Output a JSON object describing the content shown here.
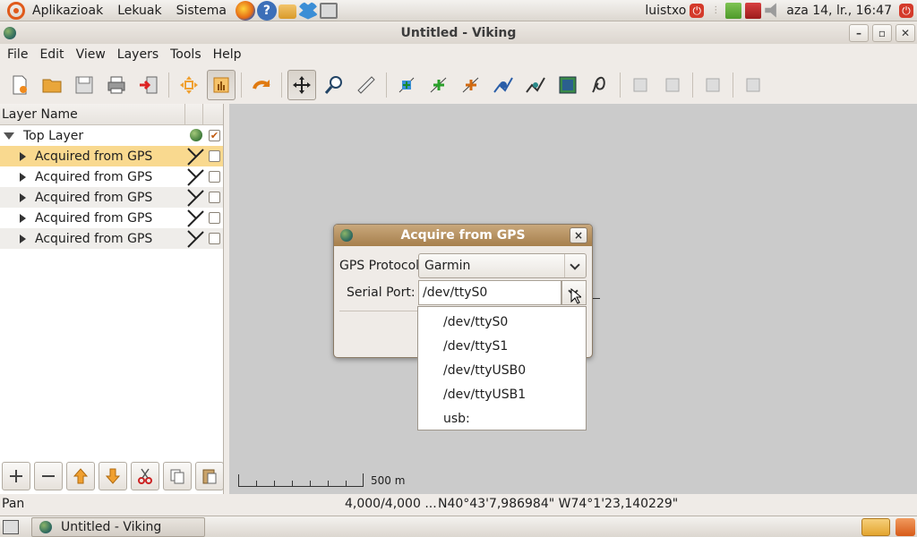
{
  "top_panel": {
    "menus": [
      "Aplikazioak",
      "Lekuak",
      "Sistema"
    ],
    "user": "luistxo",
    "clock": "aza 14, lr., 16:47",
    "help_glyph": "?"
  },
  "window": {
    "title": "Untitled - Viking",
    "buttons": [
      "–",
      "▫",
      "✕"
    ]
  },
  "menubar": [
    "File",
    "Edit",
    "View",
    "Layers",
    "Tools",
    "Help"
  ],
  "toolbar": {
    "buttons": [
      "new-file",
      "open-folder",
      "save",
      "print",
      "exit",
      "pan-center",
      "hand",
      "redo",
      "move",
      "zoom",
      "ruler",
      "create-waypoint",
      "add-point",
      "edit-point",
      "create-track",
      "edit-track",
      "map-image",
      "georef",
      "disabled-1",
      "disabled-2",
      "disabled-3",
      "disabled-4"
    ]
  },
  "layers_panel": {
    "header": "Layer Name",
    "top_layer": "Top Layer",
    "rows": [
      {
        "label": "Acquired from GPS"
      },
      {
        "label": "Acquired from GPS"
      },
      {
        "label": "Acquired from GPS"
      },
      {
        "label": "Acquired from GPS"
      },
      {
        "label": "Acquired from GPS"
      }
    ]
  },
  "map": {
    "scale_label": "500 m"
  },
  "statusbar": {
    "tool": "Pan",
    "zoom": "4,000/4,000 ...",
    "position": "N40°43'7,986984\" W74°1'23,140229\""
  },
  "taskbar": {
    "task": "Untitled - Viking"
  },
  "dialog": {
    "title": "Acquire from GPS",
    "close_glyph": "×",
    "protocol_label": "GPS Protocol:",
    "protocol_value": "Garmin",
    "port_label": "Serial Port:",
    "port_value": "/dev/ttyS0",
    "port_options": [
      "/dev/ttyS0",
      "/dev/ttyS1",
      "/dev/ttyUSB0",
      "/dev/ttyUSB1",
      "usb:"
    ]
  },
  "colors": {
    "selection": "#f9d98f",
    "dialog_title": "#b18c5a",
    "map_bg": "#cbcbcb"
  }
}
